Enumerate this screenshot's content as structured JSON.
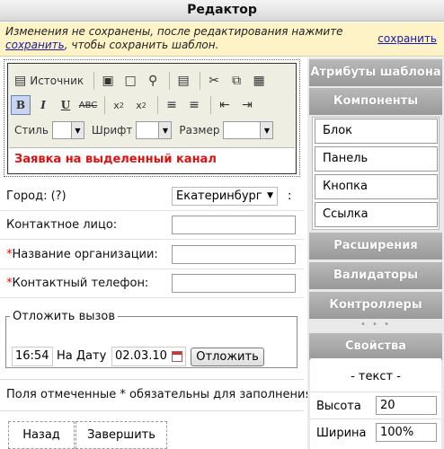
{
  "window": {
    "title": "Редактор"
  },
  "warning": {
    "text_before": "Изменения не сохранены, после редактирования нажмите ",
    "link": "сохранить",
    "text_after": ", чтобы сохранить шаблон.",
    "save_link": "сохранить"
  },
  "editor": {
    "source_label": "Источник",
    "style_label": "Стиль",
    "font_label": "Шрифт",
    "size_label": "Размер",
    "content": "Заявка на выделенный канал",
    "icons": [
      "source-icon",
      "save-icon",
      "new-page-icon",
      "preview-icon",
      "template-icon",
      "cut-icon",
      "copy-icon",
      "paste-icon",
      "bold-icon",
      "italic-icon",
      "underline-icon",
      "strike-icon",
      "subscript-icon",
      "superscript-icon",
      "ordered-list-icon",
      "bullet-list-icon",
      "outdent-icon",
      "indent-icon"
    ]
  },
  "form": {
    "city_label": "Город: (?)",
    "city_value": "Екатеринбург",
    "contact_label": "Контактное лицо:",
    "org_label": "Название организации:",
    "phone_label": "Контактный телефон:",
    "required_mark": "*",
    "delay_legend": "Отложить вызов",
    "time_value": "16:54",
    "date_label": "На Дату",
    "date_value": "02.03.10",
    "postpone_button": "Отложить",
    "required_note": "Поля отмеченные * обязательны для заполнения",
    "back_button": "Назад",
    "finish_button": "Завершить"
  },
  "sidebar": {
    "attributes": "Атрибуты шаблона",
    "components": "Компоненты",
    "component_items": [
      "Блок",
      "Панель",
      "Кнопка",
      "Ссылка"
    ],
    "extensions": "Расширения",
    "validators": "Валидаторы",
    "controllers": "Контроллеры",
    "dots": "• • •",
    "properties": "Свойства",
    "prop_title": "-  текст -",
    "height_label": "Высота",
    "height_value": "20",
    "width_label": "Ширина",
    "width_value": "100%"
  }
}
